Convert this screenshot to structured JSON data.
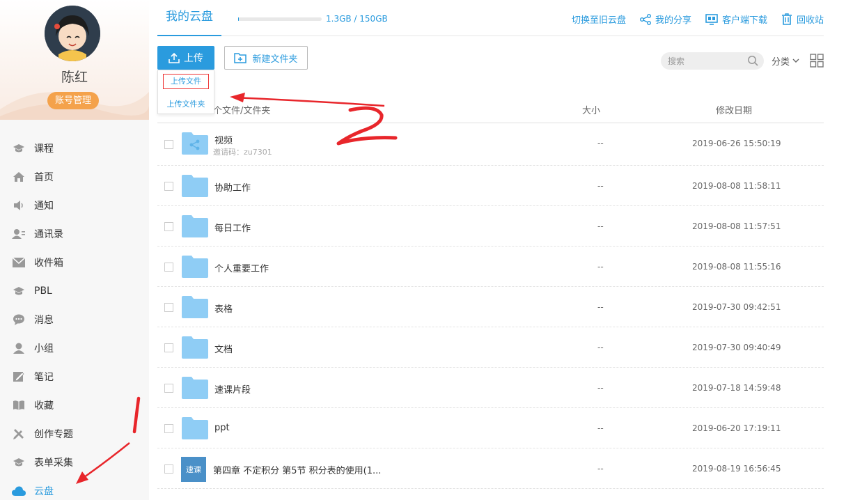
{
  "colors": {
    "accent": "#2a9bde",
    "orange": "#f4a24b",
    "folder": "#8fcdf5",
    "annotation": "#e8262b"
  },
  "sidebar": {
    "user_name": "陈红",
    "account_button": "账号管理",
    "items": [
      {
        "label": "课程",
        "icon": "graduation-cap-icon"
      },
      {
        "label": "首页",
        "icon": "home-icon"
      },
      {
        "label": "通知",
        "icon": "speaker-icon"
      },
      {
        "label": "通讯录",
        "icon": "contacts-icon"
      },
      {
        "label": "收件箱",
        "icon": "inbox-icon"
      },
      {
        "label": "PBL",
        "icon": "graduation-cap-icon"
      },
      {
        "label": "消息",
        "icon": "chat-bubble-icon"
      },
      {
        "label": "小组",
        "icon": "person-icon"
      },
      {
        "label": "笔记",
        "icon": "note-icon"
      },
      {
        "label": "收藏",
        "icon": "book-icon"
      },
      {
        "label": "创作专题",
        "icon": "pencil-ruler-icon"
      },
      {
        "label": "表单采集",
        "icon": "graduation-cap-icon"
      },
      {
        "label": "云盘",
        "icon": "cloud-icon",
        "active": true
      }
    ]
  },
  "header": {
    "tab": "我的云盘",
    "storage_text": "1.3GB / 150GB",
    "storage_fraction": 0.009,
    "actions": [
      "切换至旧云盘",
      "我的分享",
      "客户端下载",
      "回收站"
    ]
  },
  "toolbar": {
    "upload": "上传",
    "new_folder": "新建文件夹",
    "upload_file": "上传文件",
    "upload_folder": "上传文件夹",
    "search_placeholder": "搜索",
    "category": "分类"
  },
  "table": {
    "headers": {
      "name": "个文件/文件夹",
      "size": "大小",
      "date": "修改日期"
    },
    "rows": [
      {
        "name": "视频",
        "sub": "邀请码：zu7301",
        "type": "shared-folder",
        "size": "--",
        "date": "2019-06-26 15:50:19"
      },
      {
        "name": "协助工作",
        "type": "folder",
        "size": "--",
        "date": "2019-08-08 11:58:11"
      },
      {
        "name": "每日工作",
        "type": "folder",
        "size": "--",
        "date": "2019-08-08 11:57:51"
      },
      {
        "name": "个人重要工作",
        "type": "folder",
        "size": "--",
        "date": "2019-08-08 11:55:16"
      },
      {
        "name": "表格",
        "type": "folder",
        "size": "--",
        "date": "2019-07-30 09:42:51"
      },
      {
        "name": "文档",
        "type": "folder",
        "size": "--",
        "date": "2019-07-30 09:40:49"
      },
      {
        "name": "速课片段",
        "type": "folder",
        "size": "--",
        "date": "2019-07-18 14:59:48"
      },
      {
        "name": "ppt",
        "type": "folder",
        "size": "--",
        "date": "2019-06-20 17:19:11"
      },
      {
        "name": "第四章 不定积分 第5节 积分表的使用(1...",
        "type": "course",
        "badge": "速课",
        "size": "--",
        "date": "2019-08-19 16:56:45"
      }
    ]
  }
}
